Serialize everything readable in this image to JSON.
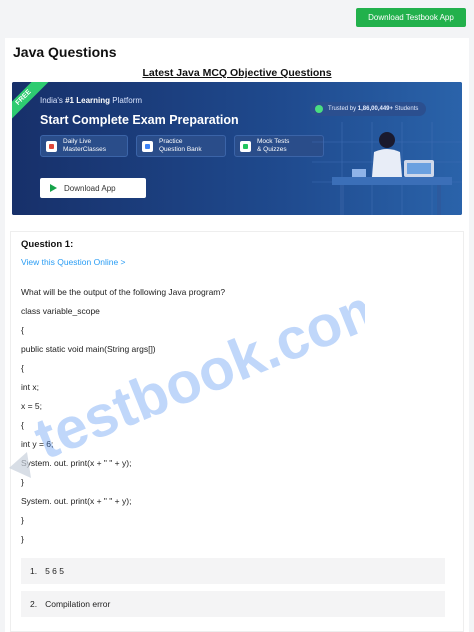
{
  "header": {
    "download_button_label": "Download Testbook App"
  },
  "page": {
    "title": "Java Questions",
    "subtitle": "Latest Java MCQ Objective Questions"
  },
  "banner": {
    "ribbon": "FREE",
    "kicker_prefix": "India's",
    "kicker_bold": "#1 Learning",
    "kicker_suffix": "Platform",
    "headline": "Start Complete Exam Preparation",
    "trust_prefix": "Trusted by",
    "trust_count": "1,86,00,449+",
    "trust_suffix": "Students",
    "features": [
      {
        "line1": "Daily Live",
        "line2": "MasterClasses"
      },
      {
        "line1": "Practice",
        "line2": "Question Bank"
      },
      {
        "line1": "Mock Tests",
        "line2": "& Quizzes"
      }
    ],
    "download_label": "Download App"
  },
  "question": {
    "heading": "Question 1:",
    "link": "View this Question Online >",
    "lines": [
      "What will be the output of the following Java program?",
      "class variable_scope",
      "{",
      "public static void main(String args[])",
      "{",
      "int x;",
      "x = 5;",
      "{",
      "int y = 6;",
      "System. out. print(x + \" \" + y);",
      "}",
      "System. out. print(x + \" \" + y);",
      "}",
      "}"
    ],
    "options": [
      {
        "num": "1.",
        "text": "5 6 5"
      },
      {
        "num": "2.",
        "text": "Compilation error"
      }
    ]
  },
  "watermark": "testbook.com"
}
